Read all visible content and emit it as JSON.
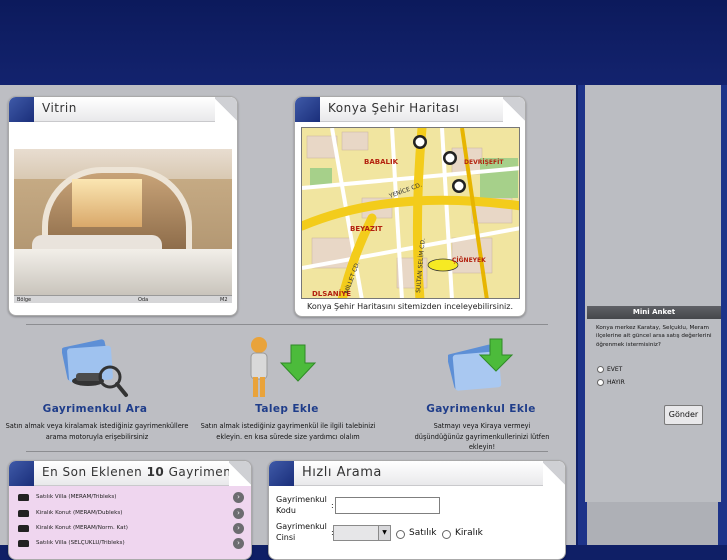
{
  "vitrin": {
    "title": "Vitrin",
    "photo_labels": [
      "Bölge",
      "Oda",
      "M2"
    ]
  },
  "map_panel": {
    "title": "Konya Şehir Haritası",
    "caption": "Konya Şehir Haritasını sitemizden inceleyebilirsiniz.",
    "street_labels": [
      "BABALIK",
      "DEVRİŞEFİT",
      "BEYAZIT",
      "ÇİĞNEYEK",
      "DLSANİYE",
      "YENİCE CD.",
      "SULTAN SELİM CD.",
      "MİLLET CD."
    ]
  },
  "features": [
    {
      "title": "Gayrimenkul Ara",
      "desc": "Satın almak veya kiralamak istediğiniz gayrimenküllere arama motoruyla erişebilirsiniz"
    },
    {
      "title": "Talep Ekle",
      "desc": "Satın almak istediğiniz gayrimenkül ile ilgili talebinizi ekleyin. en kısa sürede size yardımcı olalım"
    },
    {
      "title": "Gayrimenkul Ekle",
      "desc": "Satmayı veya Kiraya vermeyi düşündüğünüz gayrimenkullerinizi lütfen ekleyin!"
    }
  ],
  "latest": {
    "title_prefix": "En Son Eklenen",
    "title_num": "10",
    "title_suffix": "Gayrimenkul",
    "items": [
      "Satılık Villa (MERAM/Tribleks)",
      "Kiralık Konut (MERAM/Dubleks)",
      "Kiralık Konut (MERAM/Norm. Kat)",
      "Satılık Villa (SELÇUKLU/Tribleks)"
    ]
  },
  "search": {
    "title": "Hızlı Arama",
    "code_label": "Gayrimenkul Kodu",
    "type_label": "Gayrimenkul Cinsi",
    "colon": ":",
    "option_sale": "Satılık",
    "option_rent": "Kiralık"
  },
  "poll": {
    "title": "Mini Anket",
    "question": "Konya merkez Karatay, Selçuklu, Meram ilçelerine ait güncel arsa satış değerlerini öğrenmek istermisiniz?",
    "options": [
      "EVET",
      "HAYIR"
    ],
    "submit": "Gönder"
  }
}
